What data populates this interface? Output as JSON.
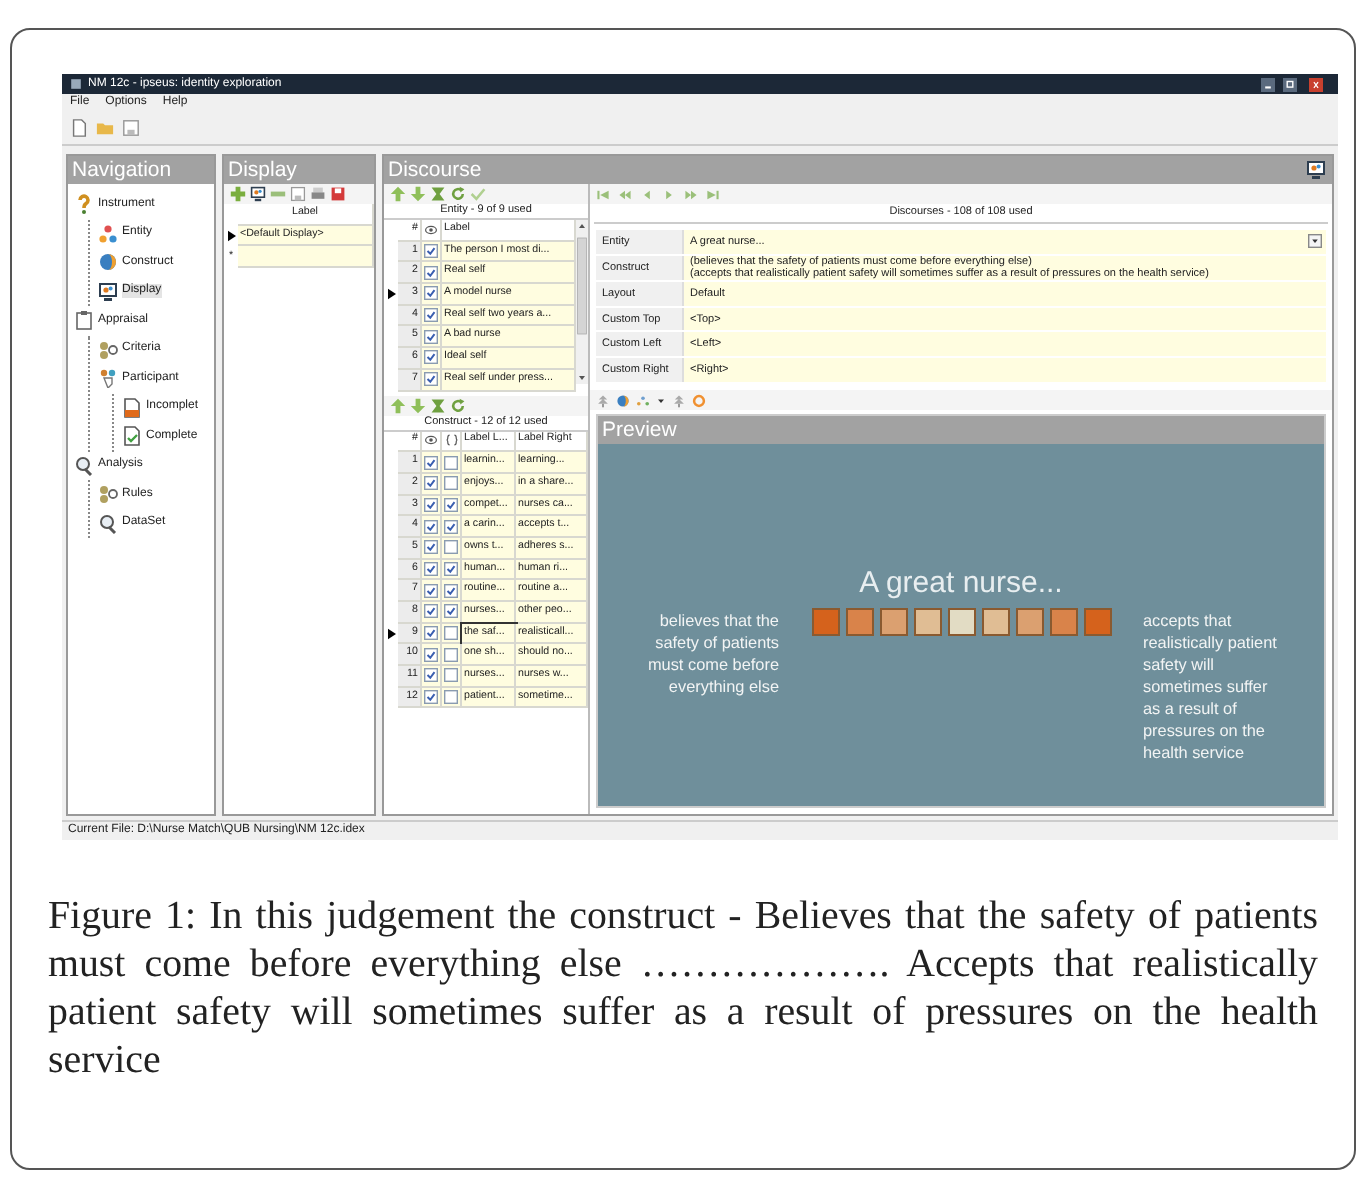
{
  "window": {
    "title": "NM 12c - ipseus: identity exploration"
  },
  "menu": [
    "File",
    "Options",
    "Help"
  ],
  "navigation": {
    "title": "Navigation",
    "items": [
      {
        "label": "Instrument",
        "selected": false,
        "children": [
          {
            "label": "Entity",
            "selected": false
          },
          {
            "label": "Construct",
            "selected": false
          },
          {
            "label": "Display",
            "selected": true
          }
        ]
      },
      {
        "label": "Appraisal",
        "selected": false,
        "children": [
          {
            "label": "Criteria",
            "selected": false
          },
          {
            "label": "Participant",
            "selected": false,
            "children": [
              {
                "label": "Incomplet",
                "selected": false
              },
              {
                "label": "Complete",
                "selected": false
              }
            ]
          }
        ]
      },
      {
        "label": "Analysis",
        "selected": false,
        "children": [
          {
            "label": "Rules",
            "selected": false
          },
          {
            "label": "DataSet",
            "selected": false
          }
        ]
      }
    ]
  },
  "display": {
    "title": "Display",
    "column": "Label",
    "rows": [
      {
        "label": "<Default Display>",
        "current": true
      }
    ],
    "new_row": "*"
  },
  "discourse": {
    "title": "Discourse",
    "entity_table": {
      "title": "Entity - 9 of 9 used",
      "columns": [
        "#",
        "Label"
      ],
      "rows": [
        {
          "number": "1",
          "visible": true,
          "label": "The person I most di...",
          "current": false
        },
        {
          "number": "2",
          "visible": true,
          "label": "Real self",
          "current": false
        },
        {
          "number": "3",
          "visible": true,
          "label": "A model nurse",
          "current": true
        },
        {
          "number": "4",
          "visible": true,
          "label": "Real self two years a...",
          "current": false
        },
        {
          "number": "5",
          "visible": true,
          "label": "A bad nurse",
          "current": false
        },
        {
          "number": "6",
          "visible": true,
          "label": "Ideal self",
          "current": false
        },
        {
          "number": "7",
          "visible": true,
          "label": "Real self under press...",
          "current": false
        }
      ]
    },
    "construct_table": {
      "title": "Construct - 12 of 12 used",
      "columns": [
        "#",
        "Label L...",
        "Label Right"
      ],
      "rows": [
        {
          "number": "1",
          "visible": true,
          "flag": false,
          "left": "learnin...",
          "right": "learning...",
          "current": false
        },
        {
          "number": "2",
          "visible": true,
          "flag": false,
          "left": "enjoys...",
          "right": "in a share...",
          "current": false
        },
        {
          "number": "3",
          "visible": true,
          "flag": true,
          "left": "compet...",
          "right": "nurses ca...",
          "current": false
        },
        {
          "number": "4",
          "visible": true,
          "flag": true,
          "left": "a carin...",
          "right": "accepts t...",
          "current": false
        },
        {
          "number": "5",
          "visible": true,
          "flag": false,
          "left": "owns t...",
          "right": "adheres s...",
          "current": false
        },
        {
          "number": "6",
          "visible": true,
          "flag": true,
          "left": "human...",
          "right": "human ri...",
          "current": false
        },
        {
          "number": "7",
          "visible": true,
          "flag": true,
          "left": "routine...",
          "right": "routine a...",
          "current": false
        },
        {
          "number": "8",
          "visible": true,
          "flag": true,
          "left": "nurses...",
          "right": "other peo...",
          "current": false
        },
        {
          "number": "9",
          "visible": true,
          "flag": false,
          "left": "the saf...",
          "right": "realisticall...",
          "current": true
        },
        {
          "number": "10",
          "visible": true,
          "flag": false,
          "left": "one sh...",
          "right": "should no...",
          "current": false
        },
        {
          "number": "11",
          "visible": true,
          "flag": false,
          "left": "nurses...",
          "right": "nurses w...",
          "current": false
        },
        {
          "number": "12",
          "visible": true,
          "flag": false,
          "left": "patient...",
          "right": "sometime...",
          "current": false
        }
      ]
    },
    "record_title": "Discourses - 108 of 108 used",
    "fields": [
      {
        "label": "Entity",
        "kind": "dropdown",
        "lines": [
          "A great nurse..."
        ]
      },
      {
        "label": "Construct",
        "kind": "text",
        "lines": [
          "(believes that the safety of patients must come before everything else)",
          "(accepts that realistically patient safety will sometimes suffer as a result of pressures on the health service)"
        ]
      },
      {
        "label": "Layout",
        "kind": "text",
        "lines": [
          "Default"
        ]
      },
      {
        "label": "Custom Top",
        "kind": "text",
        "lines": [
          "<Top>"
        ]
      },
      {
        "label": "Custom Left",
        "kind": "text",
        "lines": [
          "<Left>"
        ]
      },
      {
        "label": "Custom Right",
        "kind": "text",
        "lines": [
          "<Right>"
        ]
      }
    ],
    "preview": {
      "title": "Preview",
      "heading": "A great nurse...",
      "left": "believes that the safety of patients must come before everything else",
      "right": "accepts that realistically patient safety will sometimes suffer as a result of pressures on the health service",
      "scale": [
        {
          "color": "#d5621c"
        },
        {
          "color": "#d9834a"
        },
        {
          "color": "#dba070"
        },
        {
          "color": "#e0bd94"
        },
        {
          "color": "#e2dcc4"
        },
        {
          "color": "#e0bd94"
        },
        {
          "color": "#dba070"
        },
        {
          "color": "#d9834a"
        },
        {
          "color": "#d5621c"
        }
      ]
    }
  },
  "status_bar": "Current File: D:\\Nurse Match\\QUB Nursing\\NM 12c.idex",
  "caption": "Figure 1: In this judgement the construct - Believes that the safety of patients must come before everything else ………………. Accepts that realistically patient safety will sometimes suffer as a result of pressures on the health service"
}
